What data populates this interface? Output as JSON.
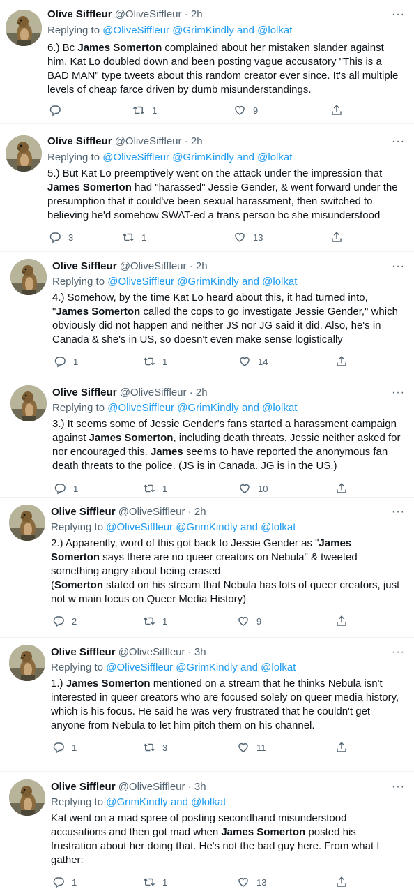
{
  "thread": [
    {
      "name": "Olive Siffleur",
      "handle": "@OliveSiffleur",
      "dot": "·",
      "time": "2h",
      "replying_prefix": "Replying to ",
      "replying_links": "@OliveSiffleur @GrimKindly and @lolkat",
      "body": [
        {
          "t": "6.) Bc "
        },
        {
          "t": "James Somerton",
          "b": true
        },
        {
          "t": " complained about her mistaken slander against him, Kat Lo doubled down and been posting vague accusatory \"This is a BAD MAN\" type tweets about this random creator ever since. It's all multiple levels of cheap farce driven by dumb misunderstandings."
        }
      ],
      "replies": "",
      "retweets": "1",
      "likes": "9"
    },
    {
      "name": "Olive Siffleur",
      "handle": "@OliveSiffleur",
      "dot": "·",
      "time": "2h",
      "replying_prefix": "Replying to ",
      "replying_links": "@OliveSiffleur @GrimKindly and @lolkat",
      "body": [
        {
          "t": "5.) But Kat Lo preemptively went on the attack under the impression that "
        },
        {
          "t": "James Somerton",
          "b": true
        },
        {
          "t": " had \"harassed\" Jessie Gender, & went forward under the presumption that it could've been sexual harassment, then switched to believing he'd somehow SWAT-ed a trans person bc she misunderstood"
        }
      ],
      "replies": "3",
      "retweets": "1",
      "likes": "13"
    },
    {
      "name": "Olive Siffleur",
      "handle": "@OliveSiffleur",
      "dot": "·",
      "time": "2h",
      "replying_prefix": "Replying to ",
      "replying_links": "@OliveSiffleur @GrimKindly and @lolkat",
      "body": [
        {
          "t": "4.) Somehow, by the time Kat Lo heard about this, it had turned into, \""
        },
        {
          "t": "James Somerton",
          "b": true
        },
        {
          "t": " called the cops to go investigate Jessie Gender,\" which obviously did not happen and neither JS nor JG said it did. Also, he's in Canada & she's in US, so doesn't even make sense logistically"
        }
      ],
      "replies": "1",
      "retweets": "1",
      "likes": "14"
    },
    {
      "name": "Olive Siffleur",
      "handle": "@OliveSiffleur",
      "dot": "·",
      "time": "2h",
      "replying_prefix": "Replying to ",
      "replying_links": "@OliveSiffleur @GrimKindly and @lolkat",
      "body": [
        {
          "t": "3.) It seems some of Jessie Gender's fans started a harassment campaign against "
        },
        {
          "t": "James Somerton",
          "b": true
        },
        {
          "t": ", including death threats. Jessie neither asked for nor encouraged this. "
        },
        {
          "t": "James",
          "b": true
        },
        {
          "t": " seems to have reported the anonymous fan death threats to the police. (JS is in Canada. JG is in the US.)"
        }
      ],
      "replies": "1",
      "retweets": "1",
      "likes": "10"
    },
    {
      "name": "Olive Siffleur",
      "handle": "@OliveSiffleur",
      "dot": "·",
      "time": "2h",
      "replying_prefix": "Replying to ",
      "replying_links": "@OliveSiffleur @GrimKindly and @lolkat",
      "body": [
        {
          "t": "2.) Apparently, word of this got back to Jessie Gender as \""
        },
        {
          "t": "James Somerton",
          "b": true
        },
        {
          "t": " says there are no queer creators on Nebula\" & tweeted something angry about being erased\n("
        },
        {
          "t": "Somerton",
          "b": true
        },
        {
          "t": " stated on his stream that Nebula has lots of queer creators, just not w main focus on Queer Media History)"
        }
      ],
      "replies": "2",
      "retweets": "1",
      "likes": "9"
    },
    {
      "name": "Olive Siffleur",
      "handle": "@OliveSiffleur",
      "dot": "·",
      "time": "3h",
      "replying_prefix": "Replying to ",
      "replying_links": "@OliveSiffleur @GrimKindly and @lolkat",
      "body": [
        {
          "t": "1.) "
        },
        {
          "t": "James Somerton",
          "b": true
        },
        {
          "t": " mentioned on a stream that he thinks Nebula isn't interested in queer creators who are focused solely on queer media history, which is his focus. He said he was very frustrated that he couldn't get anyone from Nebula to let him pitch them on his channel."
        }
      ],
      "replies": "1",
      "retweets": "3",
      "likes": "11"
    },
    {
      "name": "Olive Siffleur",
      "handle": "@OliveSiffleur",
      "dot": "·",
      "time": "3h",
      "replying_prefix": "Replying to ",
      "replying_links": "@GrimKindly and @lolkat",
      "body": [
        {
          "t": "Kat went on a mad spree of posting secondhand misunderstood accusations and then got mad when "
        },
        {
          "t": "James Somerton",
          "b": true
        },
        {
          "t": " posted his frustration about her doing that. He's not the bad guy here. From what I gather:"
        }
      ],
      "replies": "1",
      "retweets": "1",
      "likes": "13"
    }
  ],
  "more_glyph": "···",
  "icons": {
    "reply": "reply-icon",
    "retweet": "retweet-icon",
    "like": "heart-icon",
    "share": "share-icon",
    "more": "more-icon"
  },
  "colors": {
    "link": "#1d9bf0",
    "secondary": "#536471",
    "text": "#0f1419"
  }
}
